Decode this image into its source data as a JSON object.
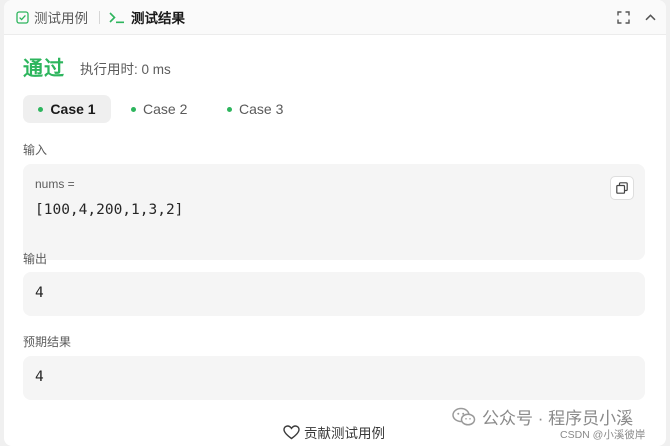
{
  "tabs": {
    "test_cases": "测试用例",
    "test_results": "测试结果"
  },
  "result": {
    "status": "通过",
    "runtime": "执行用时: 0 ms"
  },
  "cases": [
    {
      "label": "Case 1",
      "active": true
    },
    {
      "label": "Case 2",
      "active": false
    },
    {
      "label": "Case 3",
      "active": false
    }
  ],
  "input": {
    "label": "输入",
    "var_name": "nums =",
    "var_value": "[100,4,200,1,3,2]"
  },
  "output": {
    "label": "输出",
    "value": "4"
  },
  "expected": {
    "label": "预期结果",
    "value": "4"
  },
  "footer": {
    "contribute": "贡献测试用例"
  },
  "watermark": {
    "main": "公众号 · 程序员小溪",
    "sub": "CSDN @小溪彼岸"
  },
  "colors": {
    "accent_green": "#2db55d"
  }
}
